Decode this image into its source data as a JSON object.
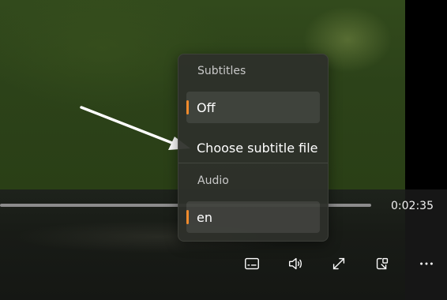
{
  "player": {
    "current_time": "0:02:35",
    "progress_fraction": 1.0
  },
  "menu": {
    "subtitles_header": "Subtitles",
    "subtitle_items": [
      {
        "label": "Off",
        "selected": true
      },
      {
        "label": "Choose subtitle file",
        "selected": false
      }
    ],
    "audio_header": "Audio",
    "audio_items": [
      {
        "label": "en",
        "selected": true
      }
    ]
  },
  "controls": {
    "icons": [
      "subtitles-icon",
      "volume-icon",
      "fullscreen-icon",
      "mini-player-icon",
      "more-icon"
    ]
  },
  "colors": {
    "accent": "#f28b2c",
    "menu_bg": "#2e302a",
    "seek_track": "#8c8c8c"
  }
}
